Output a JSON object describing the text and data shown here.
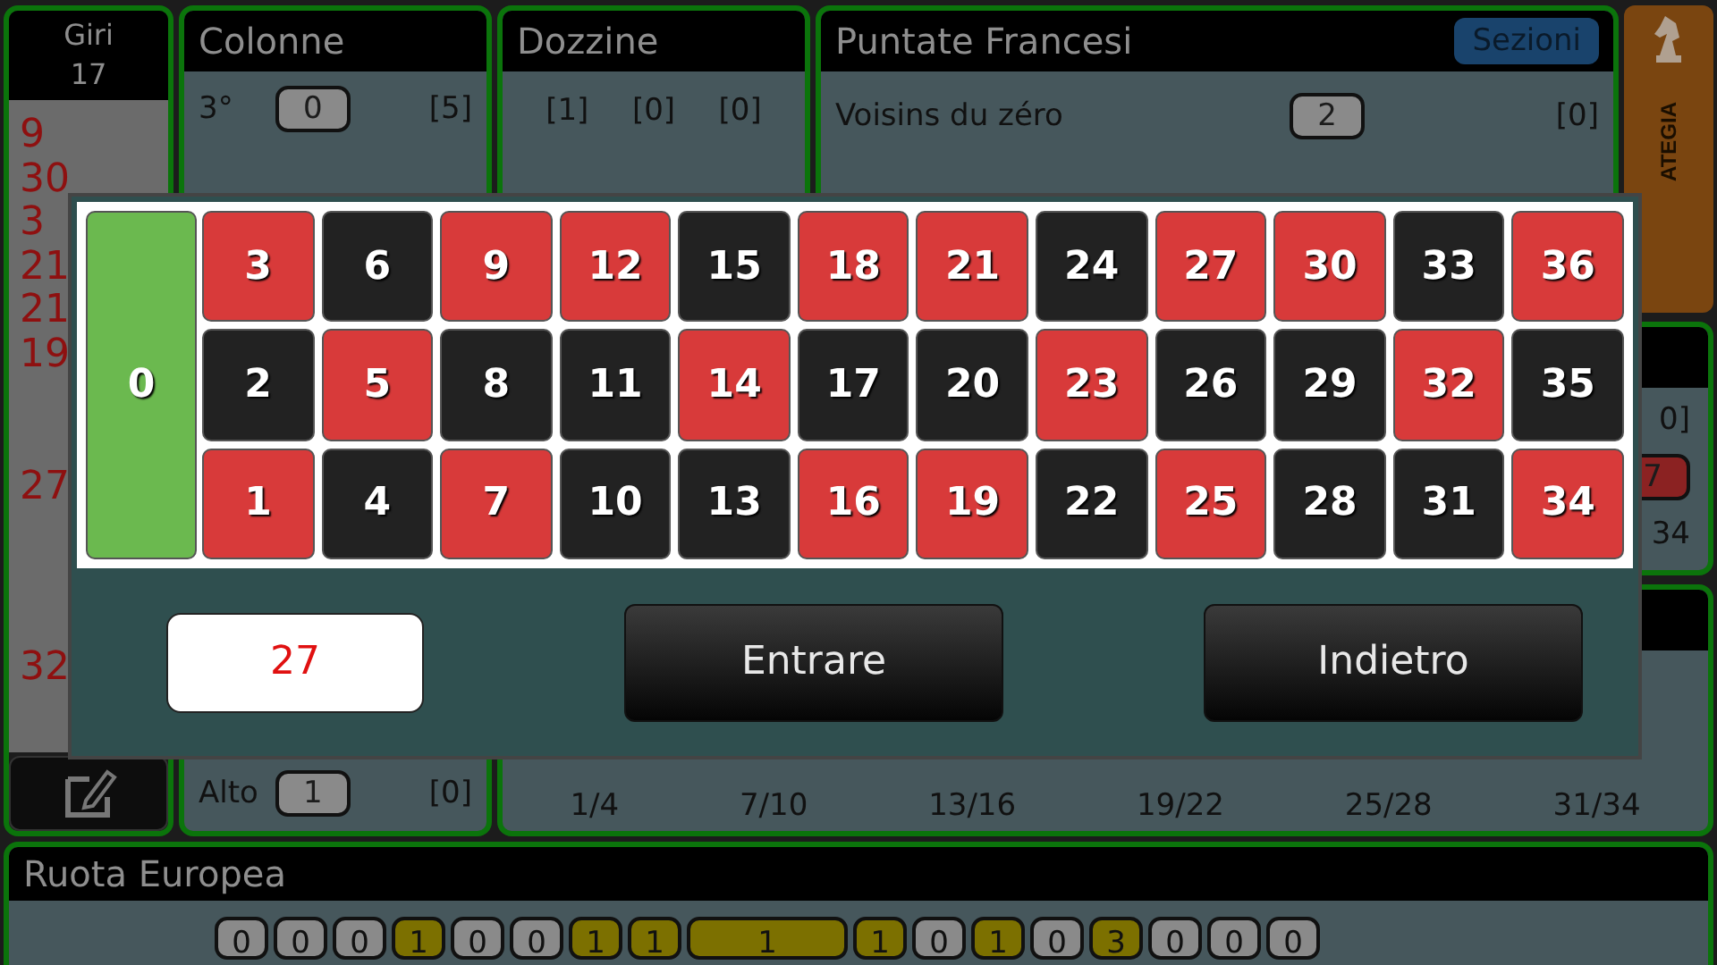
{
  "giri": {
    "title": "Giri",
    "count": "17",
    "groups": [
      [
        "9",
        "30",
        "3",
        "21",
        "21",
        "19"
      ],
      [
        "27"
      ],
      [
        "32"
      ]
    ]
  },
  "colonne": {
    "title": "Colonne",
    "top_row": {
      "label": "3°",
      "pill": "0",
      "bracket": "[5]"
    },
    "bottom_row": {
      "label": "Alto",
      "pill": "1",
      "bracket": "[0]"
    }
  },
  "dozzine": {
    "title": "Dozzine",
    "brackets": [
      "[1]",
      "[0]",
      "[0]"
    ]
  },
  "puntate_francesi": {
    "title": "Puntate Francesi",
    "button": "Sezioni",
    "row": {
      "label": "Voisins du zéro",
      "pill": "2",
      "bracket": "[0]"
    }
  },
  "strategia_tab": {
    "label": "ATEGIA"
  },
  "side_panel": {
    "items": [
      {
        "kind": "text",
        "text": "0]"
      },
      {
        "kind": "red-pill",
        "text": "7"
      },
      {
        "kind": "text",
        "text": "34"
      }
    ]
  },
  "lower_panel": {
    "labels": [
      "1/4",
      "7/10",
      "13/16",
      "19/22",
      "25/28",
      "31/34"
    ]
  },
  "ruota": {
    "title": "Ruota Europea",
    "pills": [
      {
        "text": "0",
        "hot": false,
        "kind": "single"
      },
      {
        "text": "0",
        "hot": false,
        "kind": "single"
      },
      {
        "text": "0",
        "hot": false,
        "kind": "single"
      },
      {
        "text": "1",
        "hot": true,
        "kind": "single"
      },
      {
        "text": "0",
        "hot": false,
        "kind": "single"
      },
      {
        "text": "0",
        "hot": false,
        "kind": "single"
      },
      {
        "text": "1",
        "hot": true,
        "kind": "single"
      },
      {
        "text": "1",
        "hot": true,
        "kind": "single"
      },
      {
        "text": "1",
        "hot": true,
        "kind": "wide"
      },
      {
        "text": "1",
        "hot": true,
        "kind": "single"
      },
      {
        "text": "0",
        "hot": false,
        "kind": "single"
      },
      {
        "text": "1",
        "hot": true,
        "kind": "single"
      },
      {
        "text": "0",
        "hot": false,
        "kind": "single"
      },
      {
        "text": "3",
        "hot": true,
        "kind": "single"
      },
      {
        "text": "0",
        "hot": false,
        "kind": "single"
      },
      {
        "text": "0",
        "hot": false,
        "kind": "single"
      },
      {
        "text": "0",
        "hot": false,
        "kind": "single"
      }
    ]
  },
  "modal": {
    "zero": {
      "number": "0",
      "color": "#6bb94f"
    },
    "rows": [
      [
        {
          "number": "3",
          "color": "#d83a3a"
        },
        {
          "number": "6",
          "color": "#222222"
        },
        {
          "number": "9",
          "color": "#d83a3a"
        },
        {
          "number": "12",
          "color": "#d83a3a"
        },
        {
          "number": "15",
          "color": "#222222"
        },
        {
          "number": "18",
          "color": "#d83a3a"
        },
        {
          "number": "21",
          "color": "#d83a3a"
        },
        {
          "number": "24",
          "color": "#222222"
        },
        {
          "number": "27",
          "color": "#d83a3a"
        },
        {
          "number": "30",
          "color": "#d83a3a"
        },
        {
          "number": "33",
          "color": "#222222"
        },
        {
          "number": "36",
          "color": "#d83a3a"
        }
      ],
      [
        {
          "number": "2",
          "color": "#222222"
        },
        {
          "number": "5",
          "color": "#d83a3a"
        },
        {
          "number": "8",
          "color": "#222222"
        },
        {
          "number": "11",
          "color": "#222222"
        },
        {
          "number": "14",
          "color": "#d83a3a"
        },
        {
          "number": "17",
          "color": "#222222"
        },
        {
          "number": "20",
          "color": "#222222"
        },
        {
          "number": "23",
          "color": "#d83a3a"
        },
        {
          "number": "26",
          "color": "#222222"
        },
        {
          "number": "29",
          "color": "#222222"
        },
        {
          "number": "32",
          "color": "#d83a3a"
        },
        {
          "number": "35",
          "color": "#222222"
        }
      ],
      [
        {
          "number": "1",
          "color": "#d83a3a"
        },
        {
          "number": "4",
          "color": "#222222"
        },
        {
          "number": "7",
          "color": "#d83a3a"
        },
        {
          "number": "10",
          "color": "#222222"
        },
        {
          "number": "13",
          "color": "#222222"
        },
        {
          "number": "16",
          "color": "#d83a3a"
        },
        {
          "number": "19",
          "color": "#d83a3a"
        },
        {
          "number": "22",
          "color": "#222222"
        },
        {
          "number": "25",
          "color": "#d83a3a"
        },
        {
          "number": "28",
          "color": "#222222"
        },
        {
          "number": "31",
          "color": "#222222"
        },
        {
          "number": "34",
          "color": "#d83a3a"
        }
      ]
    ],
    "value": "27",
    "buttons": [
      "Entrare",
      "Indietro"
    ]
  }
}
